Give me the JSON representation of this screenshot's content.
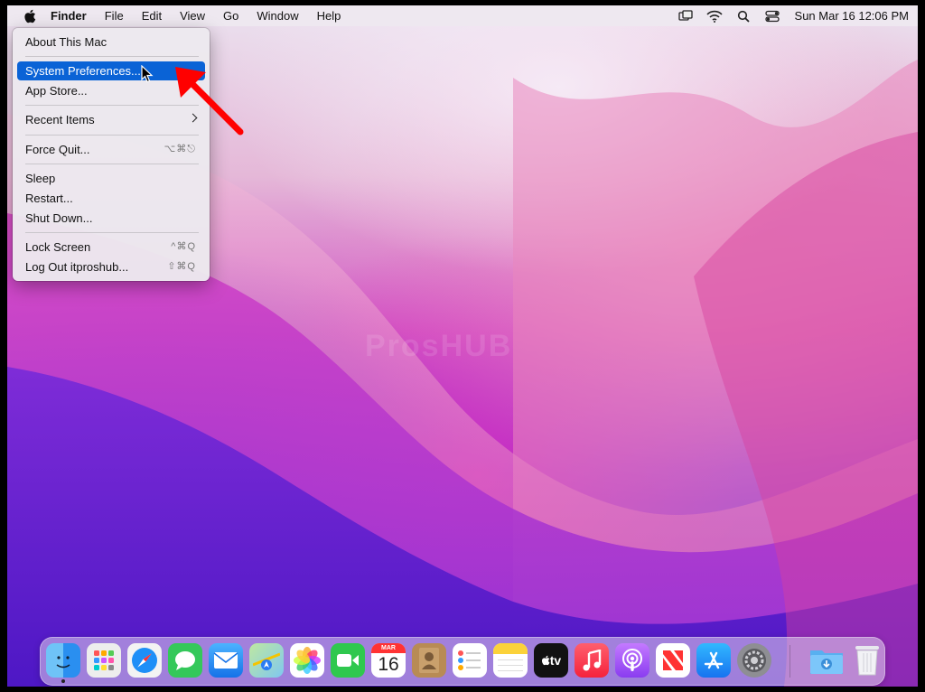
{
  "menubar": {
    "app_name": "Finder",
    "items": [
      "File",
      "Edit",
      "View",
      "Go",
      "Window",
      "Help"
    ],
    "clock": "Sun Mar 16  12:06 PM"
  },
  "apple_menu": {
    "about": "About This Mac",
    "system_preferences": "System Preferences...",
    "app_store": "App Store...",
    "recent_items": "Recent Items",
    "force_quit": "Force Quit...",
    "force_quit_shortcut": "⌥⌘⎋",
    "sleep": "Sleep",
    "restart": "Restart...",
    "shut_down": "Shut Down...",
    "lock_screen": "Lock Screen",
    "lock_screen_shortcut": "^⌘Q",
    "log_out": "Log Out itproshub...",
    "log_out_shortcut": "⇧⌘Q",
    "highlight_color": "#0a63d6"
  },
  "watermark": "ProsHUB",
  "dock": {
    "calendar_month": "MAR",
    "calendar_day": "16",
    "tv_label": "tv",
    "icons": [
      "finder-icon",
      "launchpad-icon",
      "safari-icon",
      "messages-icon",
      "mail-icon",
      "maps-icon",
      "photos-icon",
      "facetime-icon",
      "calendar-icon",
      "contacts-icon",
      "reminders-icon",
      "notes-icon",
      "apple-tv-icon",
      "music-icon",
      "podcasts-icon",
      "news-icon",
      "app-store-icon",
      "system-preferences-icon",
      "downloads-folder-icon",
      "trash-icon"
    ]
  }
}
